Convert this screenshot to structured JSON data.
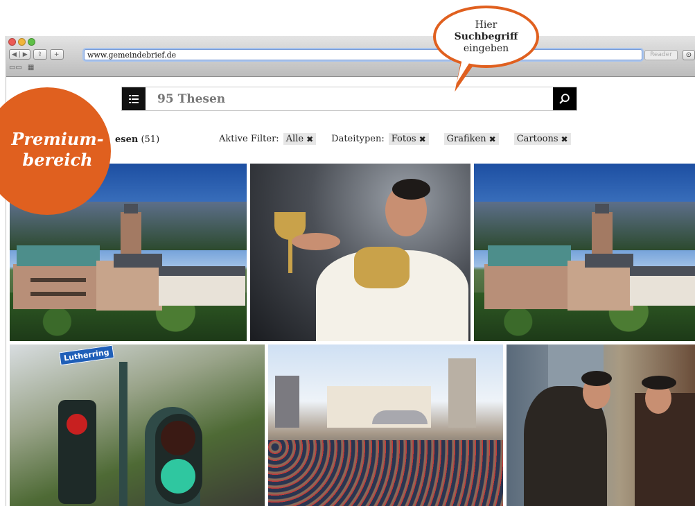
{
  "browser": {
    "url": "www.gemeindebrief.de",
    "reader_label": "Reader",
    "nav_back": "◀",
    "nav_forward": "▶",
    "share": "⇪",
    "add": "+"
  },
  "search": {
    "query": "95 Thesen"
  },
  "results": {
    "title_fragment": "esen",
    "count": "(51)"
  },
  "filters": {
    "active_label": "Aktive Filter:",
    "active": [
      "Alle"
    ],
    "filetypes_label": "Dateitypen:",
    "filetypes": [
      "Fotos",
      "Grafiken",
      "Cartoons"
    ],
    "remove_glyph": "✖"
  },
  "callout": {
    "line1": "Hier",
    "line2": "Suchbegriff",
    "line3": "eingeben"
  },
  "badge": {
    "line1": "Premium-",
    "line2": "bereich"
  },
  "photos": {
    "street_sign": "Lutherring"
  },
  "colors": {
    "accent": "#e0601f"
  }
}
